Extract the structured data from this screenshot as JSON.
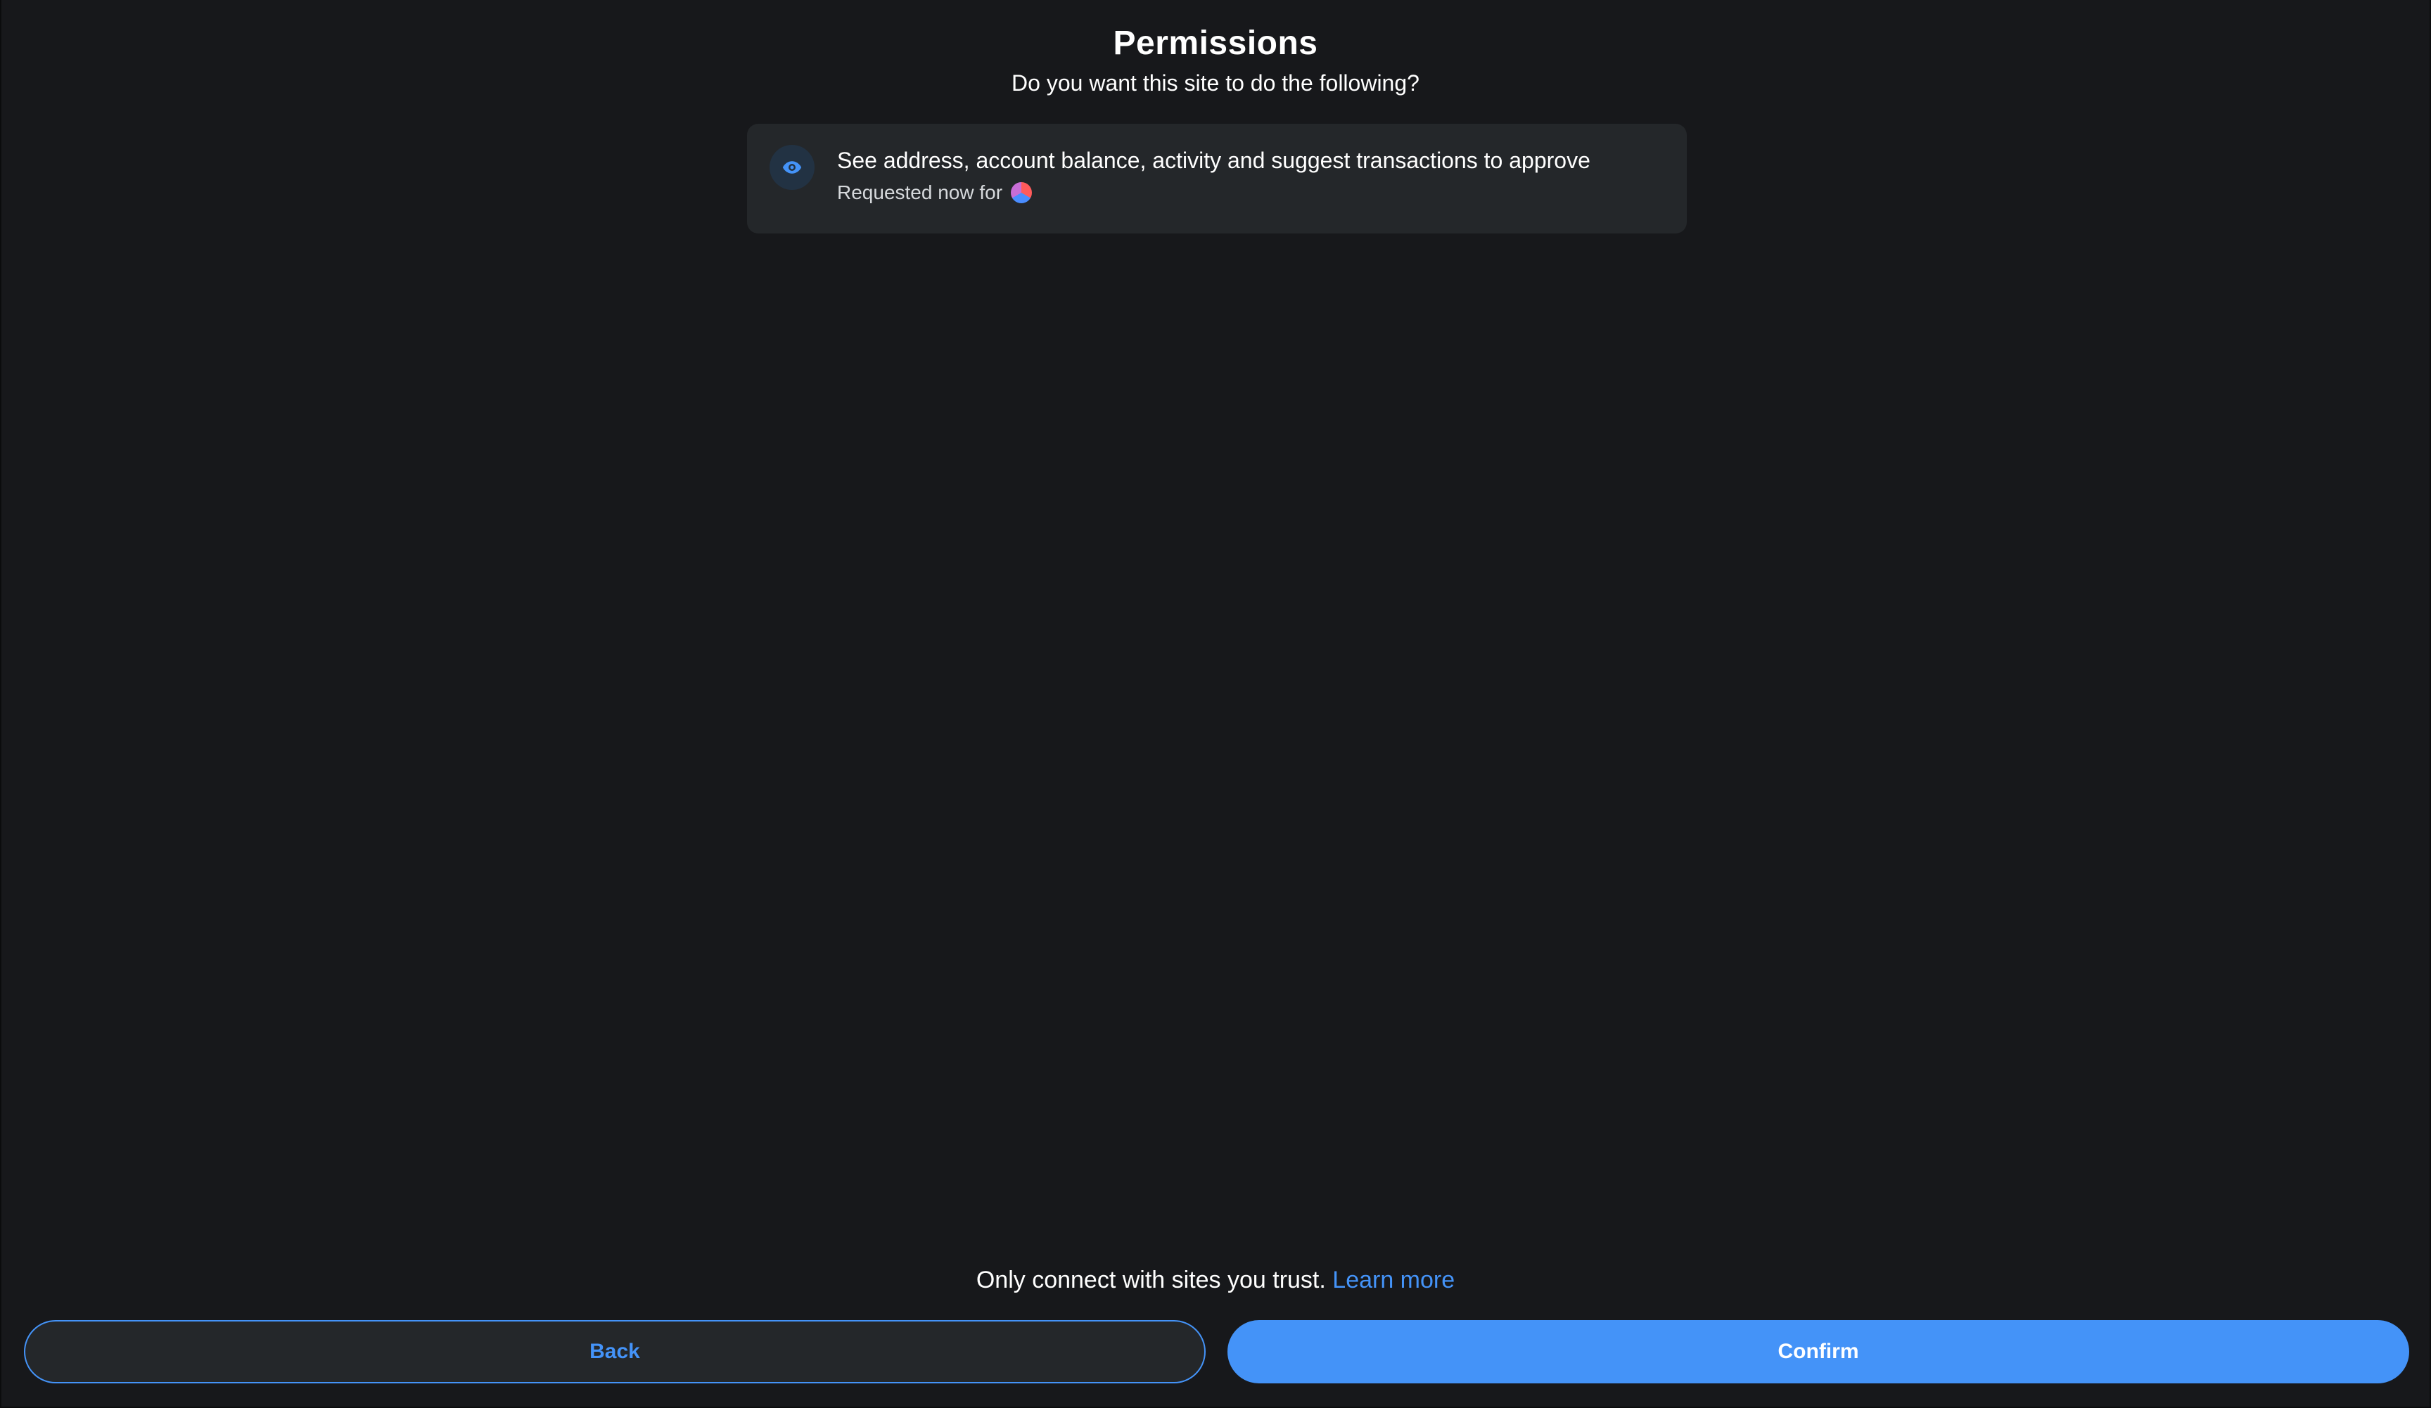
{
  "header": {
    "title": "Permissions",
    "subtitle": "Do you want this site to do the following?"
  },
  "permission": {
    "icon": "eye-icon",
    "description": "See address, account balance, activity and suggest transactions to approve",
    "meta_label": "Requested now for"
  },
  "footer": {
    "note": "Only connect with sites you trust.",
    "learn_more": "Learn more"
  },
  "actions": {
    "back_label": "Back",
    "confirm_label": "Confirm"
  },
  "colors": {
    "background": "#17181b",
    "card": "#24272a",
    "accent": "#4493f8",
    "text": "#ffffff"
  }
}
